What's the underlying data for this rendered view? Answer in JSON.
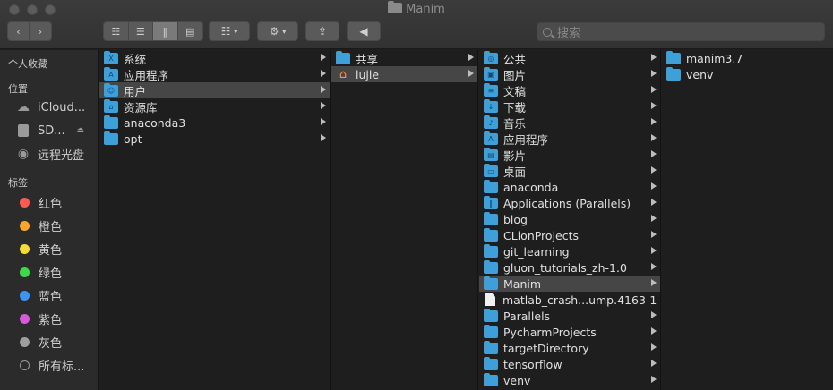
{
  "window": {
    "title": "Manim"
  },
  "toolbar": {
    "back_icon": "chevron-left-icon",
    "forward_icon": "chevron-right-icon",
    "search_placeholder": "搜索"
  },
  "sidebar": {
    "favorites_header": "个人收藏",
    "locations_header": "位置",
    "tags_header": "标签",
    "locations": [
      {
        "label": "iCloud...",
        "icon": "cloud-icon"
      },
      {
        "label": "SD...",
        "icon": "disk-icon"
      },
      {
        "label": "远程光盘",
        "icon": "optical-disc-icon"
      }
    ],
    "tags": [
      {
        "label": "红色",
        "color": "#ff5a52"
      },
      {
        "label": "橙色",
        "color": "#fda72a"
      },
      {
        "label": "黄色",
        "color": "#f6dd31"
      },
      {
        "label": "绿色",
        "color": "#3fd84b"
      },
      {
        "label": "蓝色",
        "color": "#3b95f5"
      },
      {
        "label": "紫色",
        "color": "#d65ad9"
      },
      {
        "label": "灰色",
        "color": "#9f9f9f"
      },
      {
        "label": "所有标...",
        "color": ""
      }
    ]
  },
  "columns": {
    "col1": [
      "系统",
      "应用程序",
      "用户",
      "资源库",
      "anaconda3",
      "opt"
    ],
    "col2": [
      "共享",
      "lujie"
    ],
    "col3": [
      "公共",
      "图片",
      "文稿",
      "下载",
      "音乐",
      "应用程序",
      "影片",
      "桌面",
      "anaconda",
      "Applications (Parallels)",
      "blog",
      "CLionProjects",
      "git_learning",
      "gluon_tutorials_zh-1.0",
      "Manim",
      "matlab_crash...ump.4163-1",
      "Parallels",
      "PycharmProjects",
      "targetDirectory",
      "tensorflow",
      "venv"
    ],
    "col4": [
      "manim3.7",
      "venv"
    ]
  },
  "colors": {
    "folder": "#3fa0d9",
    "selection": "#464646",
    "home": "#e9a13b"
  }
}
